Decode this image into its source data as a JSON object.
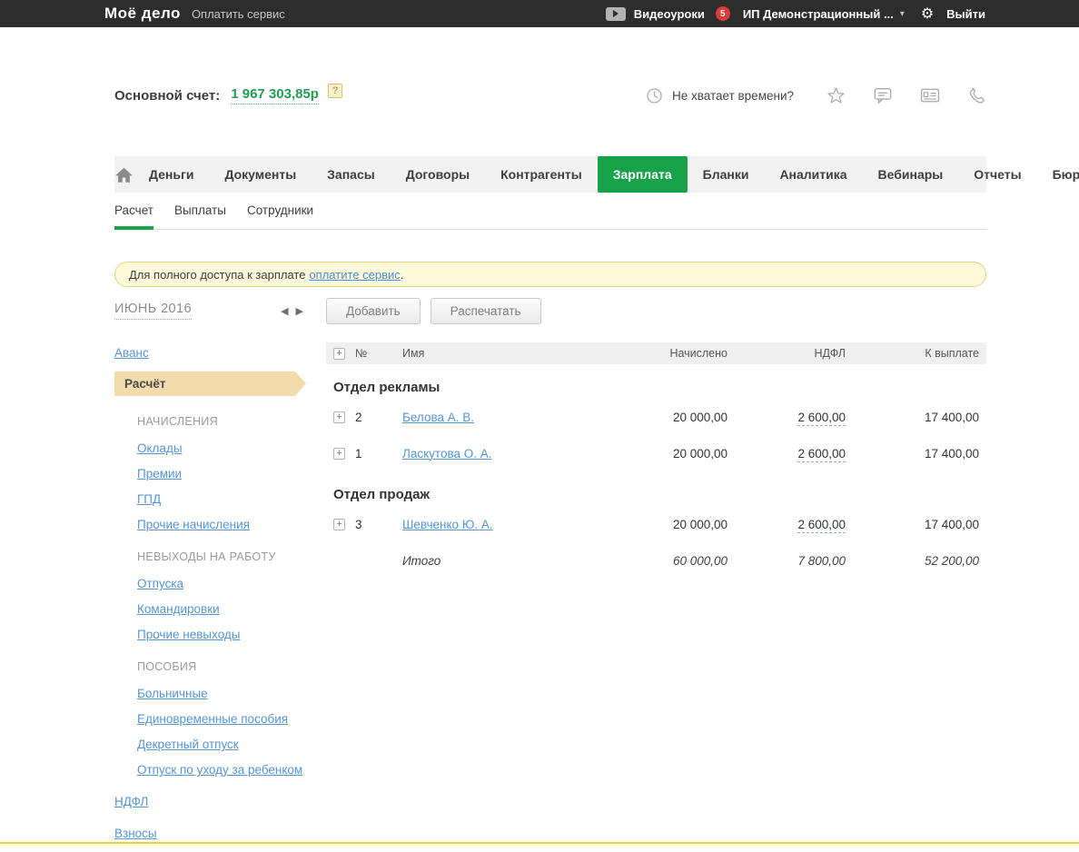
{
  "colors": {
    "accent_green": "#17a24a",
    "badge_red": "#dd3b3b",
    "link_blue": "#5694d2",
    "active_item_beige": "#f3dcab",
    "notice_bg": "#fdf8d9",
    "topbar_bg": "#2d2d2d"
  },
  "icons": {
    "prev": "◀",
    "next": "▶",
    "caret_down": "▾",
    "gear": "⚙"
  },
  "topbar": {
    "logo": "Моё дело",
    "pay_service": "Оплатить сервис",
    "videos": "Видеоуроки",
    "videos_badge": "5",
    "account": "ИП Демонстрационный ...",
    "logout": "Выйти"
  },
  "balance": {
    "label": "Основной счет:",
    "value": "1 967 303,85р",
    "help": "?"
  },
  "promo": {
    "no_time": "Не хватает времени?"
  },
  "nav": {
    "tabs": [
      "Деньги",
      "Документы",
      "Запасы",
      "Договоры",
      "Контрагенты",
      "Зарплата",
      "Бланки",
      "Аналитика",
      "Вебинары",
      "Отчеты",
      "Бюро"
    ],
    "active": "Зарплата"
  },
  "subnav": {
    "tabs": [
      "Расчет",
      "Выплаты",
      "Сотрудники"
    ],
    "active": "Расчет"
  },
  "notice": {
    "text": "Для полного доступа к зарплате",
    "link": "оплатите сервис",
    "period": "."
  },
  "toolbar": {
    "month": "ИЮНЬ 2016",
    "add": "Добавить",
    "print": "Распечатать"
  },
  "sidebar": {
    "items": [
      {
        "label": "Аванс",
        "kind": "link"
      },
      {
        "label": "Расчёт",
        "kind": "active"
      },
      {
        "label": "НАЧИСЛЕНИЯ",
        "kind": "section"
      },
      {
        "label": "Оклады",
        "kind": "sublink"
      },
      {
        "label": "Премии",
        "kind": "sublink"
      },
      {
        "label": "ГПД",
        "kind": "sublink"
      },
      {
        "label": "Прочие начисления",
        "kind": "sublink"
      },
      {
        "label": "НЕВЫХОДЫ НА РАБОТУ",
        "kind": "section"
      },
      {
        "label": "Отпуска",
        "kind": "sublink"
      },
      {
        "label": "Командировки",
        "kind": "sublink"
      },
      {
        "label": "Прочие невыходы",
        "kind": "sublink"
      },
      {
        "label": "ПОСОБИЯ",
        "kind": "section"
      },
      {
        "label": "Больничные",
        "kind": "sublink"
      },
      {
        "label": "Единовременные пособия",
        "kind": "sublink"
      },
      {
        "label": "Декретный отпуск",
        "kind": "sublink"
      },
      {
        "label": "Отпуск по уходу за ребенком",
        "kind": "sublink"
      },
      {
        "label": "НДФЛ",
        "kind": "rootlink"
      },
      {
        "label": "Взносы",
        "kind": "rootlink"
      }
    ]
  },
  "table": {
    "headers": {
      "num": "№",
      "name": "Имя",
      "accrued": "Начислено",
      "ndfl": "НДФЛ",
      "payable": "К выплате"
    },
    "groups": [
      {
        "name": "Отдел рекламы",
        "rows": [
          {
            "num": "2",
            "name": "Белова А. В.",
            "accrued": "20 000,00",
            "ndfl": "2 600,00",
            "payable": "17 400,00"
          },
          {
            "num": "1",
            "name": "Ласкутова О. А.",
            "accrued": "20 000,00",
            "ndfl": "2 600,00",
            "payable": "17 400,00"
          }
        ]
      },
      {
        "name": "Отдел продаж",
        "rows": [
          {
            "num": "3",
            "name": "Шевченко Ю. А.",
            "accrued": "20 000,00",
            "ndfl": "2 600,00",
            "payable": "17 400,00"
          }
        ]
      }
    ],
    "total": {
      "label": "Итого",
      "accrued": "60 000,00",
      "ndfl": "7 800,00",
      "payable": "52 200,00"
    }
  }
}
